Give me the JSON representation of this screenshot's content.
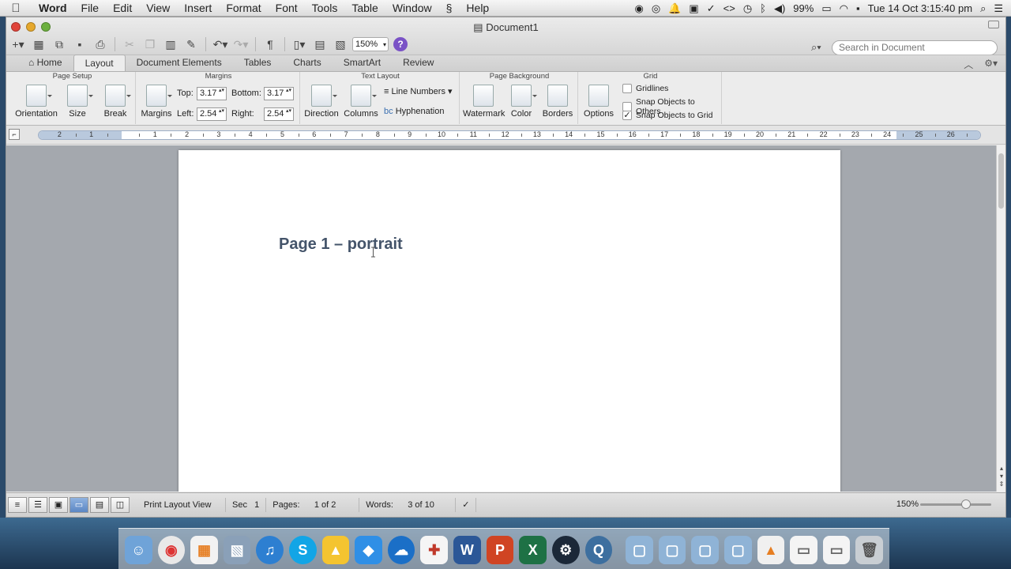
{
  "menubar": {
    "app_name": "Word",
    "items": [
      "File",
      "Edit",
      "View",
      "Insert",
      "Format",
      "Font",
      "Tools",
      "Table",
      "Window",
      "Help"
    ],
    "battery": "99%",
    "datetime": "Tue 14 Oct  3:15:40 pm"
  },
  "window": {
    "title": "Document1"
  },
  "toolbar": {
    "zoom": "150%",
    "help": "?",
    "search_placeholder": "Search in Document"
  },
  "tabs": [
    "Home",
    "Layout",
    "Document Elements",
    "Tables",
    "Charts",
    "SmartArt",
    "Review"
  ],
  "active_tab": "Layout",
  "ribbon": {
    "page_setup": {
      "title": "Page Setup",
      "orientation": "Orientation",
      "size": "Size",
      "break": "Break"
    },
    "margins": {
      "title": "Margins",
      "margins_btn": "Margins",
      "top_label": "Top:",
      "top": "3.17",
      "bottom_label": "Bottom:",
      "bottom": "3.17",
      "left_label": "Left:",
      "left": "2.54",
      "right_label": "Right:",
      "right": "2.54"
    },
    "text_layout": {
      "title": "Text Layout",
      "direction": "Direction",
      "columns": "Columns",
      "line_numbers": "Line Numbers",
      "hyphenation": "Hyphenation"
    },
    "page_background": {
      "title": "Page Background",
      "watermark": "Watermark",
      "color": "Color",
      "borders": "Borders"
    },
    "grid": {
      "title": "Grid",
      "options": "Options",
      "gridlines": "Gridlines",
      "snap_others": "Snap Objects to Others",
      "snap_grid": "Snap Objects to Grid"
    }
  },
  "ruler": {
    "left_numbers": [
      "2",
      "1"
    ],
    "numbers": [
      "1",
      "2",
      "3",
      "4",
      "5",
      "6",
      "7",
      "8",
      "9",
      "10",
      "11",
      "12",
      "13",
      "14",
      "15",
      "16",
      "17",
      "18",
      "19",
      "20",
      "21",
      "22",
      "23",
      "24",
      "25",
      "26"
    ]
  },
  "document": {
    "heading": "Page 1 – portrait"
  },
  "statusbar": {
    "view": "Print Layout View",
    "sec_label": "Sec",
    "sec": "1",
    "pages_label": "Pages:",
    "pages": "1 of 2",
    "words_label": "Words:",
    "words": "3 of 10",
    "zoom": "150%"
  },
  "colors": {
    "heading": "#44546a",
    "help_purple": "#7a52c6"
  }
}
